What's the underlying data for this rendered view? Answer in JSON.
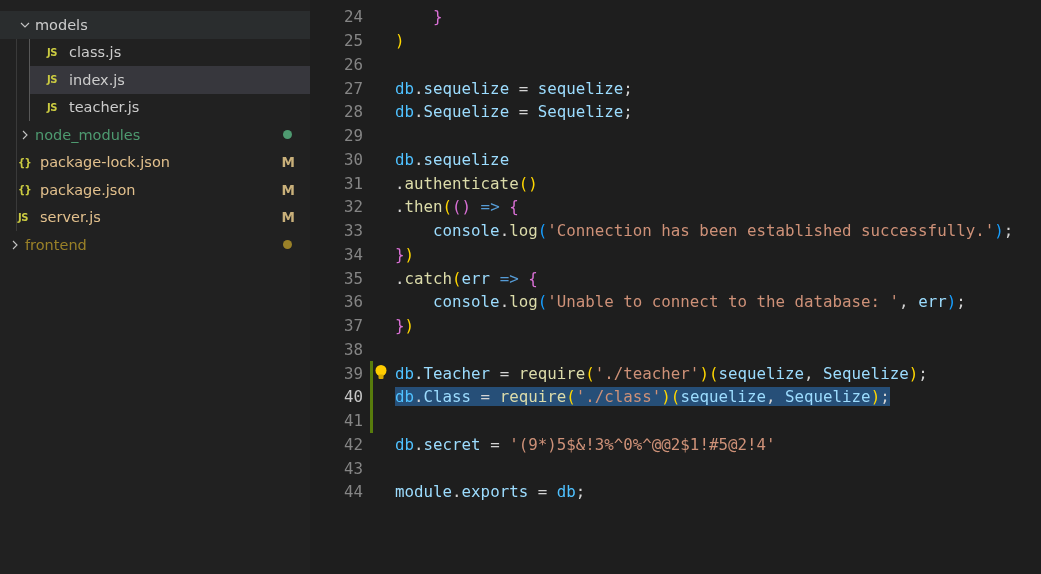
{
  "explorer": {
    "tree": [
      {
        "children": [
          {
            "label": "models",
            "kind": "folder",
            "expanded": true,
            "selected": false,
            "hovered": true,
            "children": [
              {
                "label": "class.js",
                "kind": "file",
                "icon": "JS",
                "selected": false,
                "hovered": false
              },
              {
                "label": "index.js",
                "kind": "file",
                "icon": "JS",
                "selected": true,
                "hovered": false
              },
              {
                "label": "teacher.js",
                "kind": "file",
                "icon": "JS",
                "selected": false,
                "hovered": false
              }
            ]
          },
          {
            "label": "node_modules",
            "kind": "folder",
            "expanded": false,
            "selected": false,
            "hovered": false,
            "color": "#4e9a70"
          },
          {
            "label": "package-lock.json",
            "kind": "file",
            "icon": "{}",
            "selected": false,
            "hovered": false,
            "badge": "M"
          },
          {
            "label": "package.json",
            "kind": "file",
            "icon": "{}",
            "selected": false,
            "hovered": false,
            "badge": "M"
          },
          {
            "label": "server.js",
            "kind": "file",
            "icon": "JS",
            "selected": false,
            "hovered": false,
            "badge": "M"
          }
        ]
      },
      {
        "label": "frontend",
        "kind": "folder",
        "expanded": false,
        "selected": false,
        "hovered": false,
        "color": "#9a8128"
      }
    ]
  },
  "editor": {
    "lines": [
      {
        "number": "24",
        "tokens": [
          {
            "kind": "bracket2",
            "text": "    }"
          }
        ]
      },
      {
        "number": "25",
        "tokens": [
          {
            "kind": "bracket1",
            "text": ")"
          }
        ]
      },
      {
        "number": "26"
      },
      {
        "number": "27",
        "tokens": [
          {
            "kind": "const",
            "text": "db"
          },
          {
            "kind": "plain",
            "text": "."
          },
          {
            "kind": "var",
            "text": "sequelize"
          },
          {
            "kind": "plain",
            "text": " = "
          },
          {
            "kind": "var",
            "text": "sequelize"
          },
          {
            "kind": "plain",
            "text": ";"
          }
        ]
      },
      {
        "number": "28",
        "tokens": [
          {
            "kind": "const",
            "text": "db"
          },
          {
            "kind": "plain",
            "text": "."
          },
          {
            "kind": "var",
            "text": "Sequelize"
          },
          {
            "kind": "plain",
            "text": " = "
          },
          {
            "kind": "var",
            "text": "Sequelize"
          },
          {
            "kind": "plain",
            "text": ";"
          }
        ]
      },
      {
        "number": "29"
      },
      {
        "number": "30",
        "tokens": [
          {
            "kind": "const",
            "text": "db"
          },
          {
            "kind": "plain",
            "text": "."
          },
          {
            "kind": "var",
            "text": "sequelize"
          }
        ]
      },
      {
        "number": "31",
        "tokens": [
          {
            "kind": "plain",
            "text": "."
          },
          {
            "kind": "fn",
            "text": "authenticate"
          },
          {
            "kind": "bracket1",
            "text": "()"
          }
        ]
      },
      {
        "number": "32",
        "tokens": [
          {
            "kind": "plain",
            "text": "."
          },
          {
            "kind": "fn",
            "text": "then"
          },
          {
            "kind": "bracket1",
            "text": "("
          },
          {
            "kind": "bracket2",
            "text": "()"
          },
          {
            "kind": "keyword",
            "text": " => "
          },
          {
            "kind": "bracket2",
            "text": "{"
          }
        ]
      },
      {
        "number": "33",
        "tokens": [
          {
            "kind": "var",
            "text": "    console"
          },
          {
            "kind": "plain",
            "text": "."
          },
          {
            "kind": "fn",
            "text": "log"
          },
          {
            "kind": "bracket3",
            "text": "("
          },
          {
            "kind": "string",
            "text": "'Connection has been established successfully.'"
          },
          {
            "kind": "bracket3",
            "text": ")"
          },
          {
            "kind": "plain",
            "text": ";"
          }
        ]
      },
      {
        "number": "34",
        "tokens": [
          {
            "kind": "bracket2",
            "text": "}"
          },
          {
            "kind": "bracket1",
            "text": ")"
          }
        ]
      },
      {
        "number": "35",
        "tokens": [
          {
            "kind": "plain",
            "text": "."
          },
          {
            "kind": "fn",
            "text": "catch"
          },
          {
            "kind": "bracket1",
            "text": "("
          },
          {
            "kind": "var",
            "text": "err"
          },
          {
            "kind": "keyword",
            "text": " => "
          },
          {
            "kind": "bracket2",
            "text": "{"
          }
        ]
      },
      {
        "number": "36",
        "tokens": [
          {
            "kind": "var",
            "text": "    console"
          },
          {
            "kind": "plain",
            "text": "."
          },
          {
            "kind": "fn",
            "text": "log"
          },
          {
            "kind": "bracket3",
            "text": "("
          },
          {
            "kind": "string",
            "text": "'Unable to connect to the database: '"
          },
          {
            "kind": "plain",
            "text": ", "
          },
          {
            "kind": "var",
            "text": "err"
          },
          {
            "kind": "bracket3",
            "text": ")"
          },
          {
            "kind": "plain",
            "text": ";"
          }
        ]
      },
      {
        "number": "37",
        "tokens": [
          {
            "kind": "bracket2",
            "text": "}"
          },
          {
            "kind": "bracket1",
            "text": ")"
          }
        ]
      },
      {
        "number": "38"
      },
      {
        "number": "39",
        "added": true,
        "lightbulb": true,
        "tokens": [
          {
            "kind": "const",
            "text": "db"
          },
          {
            "kind": "plain",
            "text": "."
          },
          {
            "kind": "var",
            "text": "Teacher"
          },
          {
            "kind": "plain",
            "text": " = "
          },
          {
            "kind": "fn",
            "text": "require"
          },
          {
            "kind": "bracket1",
            "text": "("
          },
          {
            "kind": "string",
            "text": "'./teacher'"
          },
          {
            "kind": "bracket1",
            "text": ")("
          },
          {
            "kind": "var",
            "text": "sequelize"
          },
          {
            "kind": "plain",
            "text": ", "
          },
          {
            "kind": "var",
            "text": "Sequelize"
          },
          {
            "kind": "bracket1",
            "text": ")"
          },
          {
            "kind": "plain",
            "text": ";"
          }
        ]
      },
      {
        "number": "40",
        "added": true,
        "current": true,
        "selected": true,
        "tokens": [
          {
            "kind": "const",
            "text": "db"
          },
          {
            "kind": "plain",
            "text": "."
          },
          {
            "kind": "var",
            "text": "Class"
          },
          {
            "kind": "plain",
            "text": " = "
          },
          {
            "kind": "fn",
            "text": "require"
          },
          {
            "kind": "bracket1",
            "text": "("
          },
          {
            "kind": "string",
            "text": "'./class'"
          },
          {
            "kind": "bracket1",
            "text": ")("
          },
          {
            "kind": "var",
            "text": "sequelize"
          },
          {
            "kind": "plain",
            "text": ", "
          },
          {
            "kind": "var",
            "text": "Sequelize"
          },
          {
            "kind": "bracket1",
            "text": ")"
          },
          {
            "kind": "plain",
            "text": ";"
          }
        ]
      },
      {
        "number": "41",
        "added": true
      },
      {
        "number": "42",
        "tokens": [
          {
            "kind": "const",
            "text": "db"
          },
          {
            "kind": "plain",
            "text": "."
          },
          {
            "kind": "var",
            "text": "secret"
          },
          {
            "kind": "plain",
            "text": " = "
          },
          {
            "kind": "string",
            "text": "'(9*)5$&!3%^0%^@@2$1!#5@2!4'"
          }
        ]
      },
      {
        "number": "43"
      },
      {
        "number": "44",
        "tokens": [
          {
            "kind": "var",
            "text": "module"
          },
          {
            "kind": "plain",
            "text": "."
          },
          {
            "kind": "var",
            "text": "exports"
          },
          {
            "kind": "plain",
            "text": " = "
          },
          {
            "kind": "const",
            "text": "db"
          },
          {
            "kind": "plain",
            "text": ";"
          }
        ]
      }
    ]
  }
}
